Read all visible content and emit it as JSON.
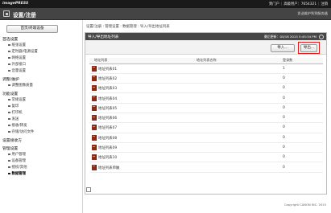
{
  "header": {
    "brand": "imagePRESS",
    "links": [
      "到门户",
      "高级用户：7654321",
      "注销"
    ],
    "title": "设置/注册",
    "right_text": "发送维护到到服务器"
  },
  "sidebar": {
    "home_button": "首页/终端设备",
    "sections": [
      {
        "label": "首选设置",
        "items": [
          "纸张设置",
          "定时器/电源设置",
          "网络设置",
          "外部接口",
          "音量设置"
        ]
      },
      {
        "label": "调整/维护",
        "items": [
          "调整图像质量"
        ]
      },
      {
        "label": "功能设置",
        "items": [
          "常规设置",
          "复印",
          "打印机",
          "发送",
          "接收/转发",
          "存储/访问文件"
        ]
      },
      {
        "label": "设置接收方",
        "items": []
      },
      {
        "label": "管理设置",
        "items": [
          "用户管理",
          "设备管理",
          "授权/其他",
          "数据管理"
        ]
      }
    ],
    "active_item": "数据管理"
  },
  "breadcrumb": "设置/注册 : 管理设置 : 数据管理 : 导入/导出地址列表",
  "panel": {
    "title": "导入/导出地址列表",
    "updated_label": "最后更新：",
    "updated_value": "05/18 2015 5:45:34 PM",
    "import_button": "导入...",
    "export_button": "导出..."
  },
  "table": {
    "headers": [
      "地址列表",
      "地址列表名称",
      "登录数"
    ],
    "rows": [
      {
        "name": "地址列表01",
        "reg_name": "",
        "count": "1"
      },
      {
        "name": "地址列表02",
        "reg_name": "",
        "count": "0"
      },
      {
        "name": "地址列表03",
        "reg_name": "",
        "count": "0"
      },
      {
        "name": "地址列表04",
        "reg_name": "",
        "count": "0"
      },
      {
        "name": "地址列表05",
        "reg_name": "",
        "count": "0"
      },
      {
        "name": "地址列表06",
        "reg_name": "",
        "count": "0"
      },
      {
        "name": "地址列表07",
        "reg_name": "",
        "count": "0"
      },
      {
        "name": "地址列表08",
        "reg_name": "",
        "count": "0"
      },
      {
        "name": "地址列表09",
        "reg_name": "",
        "count": "0"
      },
      {
        "name": "地址列表10",
        "reg_name": "",
        "count": "0"
      },
      {
        "name": "地址列表单触",
        "reg_name": "",
        "count": "0"
      }
    ]
  },
  "footer": "Copyright CANON INC. 2015",
  "colors": {
    "header_bg": "#1a1a1a",
    "titlebar_bg": "#444444",
    "highlight": "#e01818",
    "book_icon": "#8a2b16"
  }
}
